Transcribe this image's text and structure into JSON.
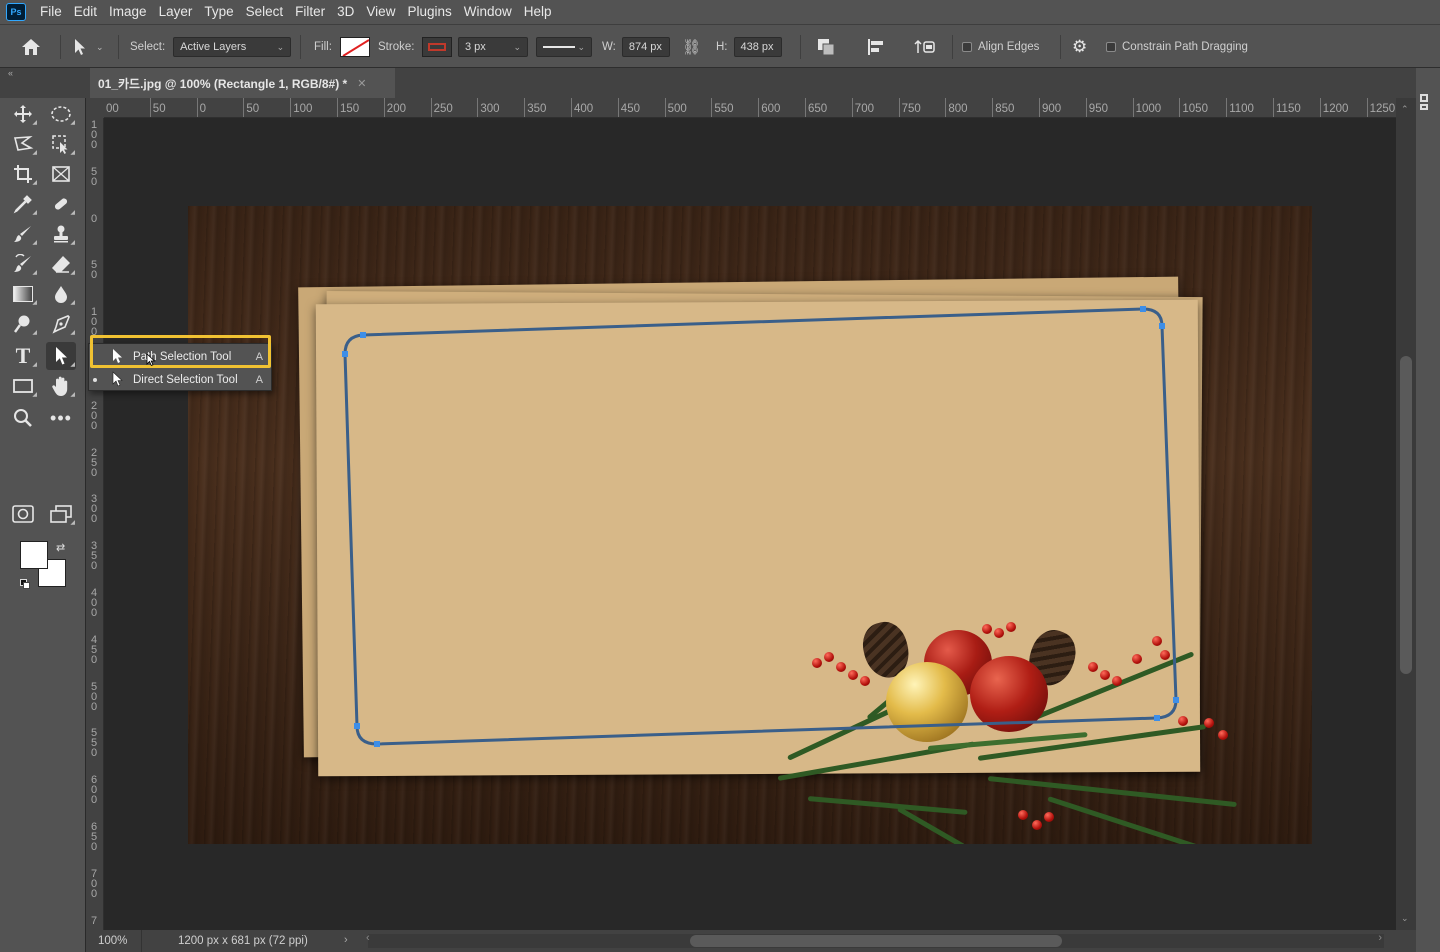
{
  "app": {
    "logo": "Ps"
  },
  "menu": [
    "File",
    "Edit",
    "Image",
    "Layer",
    "Type",
    "Select",
    "Filter",
    "3D",
    "View",
    "Plugins",
    "Window",
    "Help"
  ],
  "options": {
    "select_label": "Select:",
    "select_value": "Active Layers",
    "fill_label": "Fill:",
    "stroke_label": "Stroke:",
    "stroke_width": "3 px",
    "w_label": "W:",
    "w_value": "874 px",
    "h_label": "H:",
    "h_value": "438 px",
    "align_edges": "Align Edges",
    "constrain": "Constrain Path Dragging",
    "stroke_color": "#c0392b"
  },
  "document": {
    "tab_title": "01_카드.jpg @ 100% (Rectangle 1, RGB/8#) *",
    "zoom": "100%",
    "info": "1200 px x 681 px (72 ppi)"
  },
  "ruler_h": [
    "00",
    "50",
    "0",
    "50",
    "100",
    "150",
    "200",
    "250",
    "300",
    "350",
    "400",
    "450",
    "500",
    "550",
    "600",
    "650",
    "700",
    "750",
    "800",
    "850",
    "900",
    "950",
    "1000",
    "1050",
    "1100",
    "1150",
    "1200",
    "1250"
  ],
  "ruler_v": [
    "100",
    "50",
    "0",
    "50",
    "100",
    "150",
    "200",
    "250",
    "300",
    "350",
    "400",
    "450",
    "500",
    "550",
    "600",
    "650",
    "700",
    "7"
  ],
  "flyout": {
    "items": [
      {
        "label": "Path Selection Tool",
        "key": "A"
      },
      {
        "label": "Direct Selection Tool",
        "key": "A"
      }
    ]
  },
  "colors": {
    "accent_highlight": "#f1c232",
    "path_stroke": "#3a5f8a",
    "anchor": "#3d8ee8"
  }
}
